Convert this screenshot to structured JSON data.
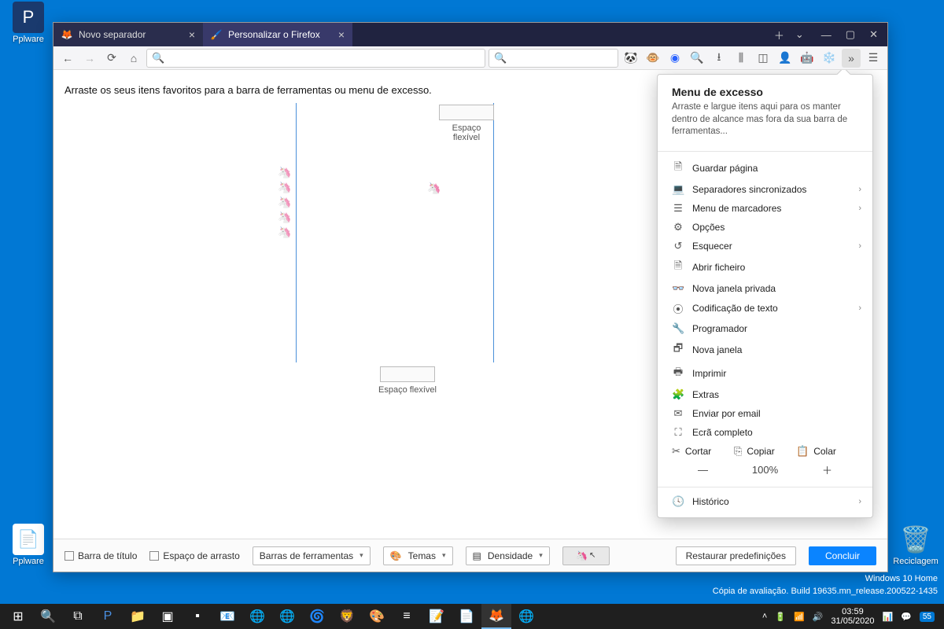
{
  "desktop": {
    "icons": [
      {
        "label": "Pplware"
      },
      {
        "label": "Pplware"
      },
      {
        "label": "Reciclagem"
      }
    ]
  },
  "window": {
    "tabs": [
      {
        "label": "Novo separador",
        "icon": "🔥",
        "active": false
      },
      {
        "label": "Personalizar o Firefox",
        "icon": "✎",
        "active": true
      }
    ]
  },
  "customize": {
    "instruction": "Arraste os seus itens favoritos para a barra de ferramentas ou menu de excesso.",
    "flex_space": "Espaço flexível"
  },
  "overflow": {
    "title": "Menu de excesso",
    "desc": "Arraste e largue itens aqui para os manter dentro de alcance mas fora da sua barra de ferramentas...",
    "items": [
      {
        "icon": "🗎",
        "label": "Guardar página",
        "arrow": false
      },
      {
        "icon": "💻",
        "label": "Separadores sincronizados",
        "arrow": true
      },
      {
        "icon": "☰",
        "label": "Menu de marcadores",
        "arrow": true
      },
      {
        "icon": "⚙",
        "label": "Opções",
        "arrow": false
      },
      {
        "icon": "↺",
        "label": "Esquecer",
        "arrow": true
      },
      {
        "icon": "🗎",
        "label": "Abrir ficheiro",
        "arrow": false
      },
      {
        "icon": "👓",
        "label": "Nova janela privada",
        "arrow": false
      },
      {
        "icon": "⦿",
        "label": "Codificação de texto",
        "arrow": true
      },
      {
        "icon": "🔧",
        "label": "Programador",
        "arrow": false
      },
      {
        "icon": "🗗",
        "label": "Nova janela",
        "arrow": false
      },
      {
        "icon": "🖶",
        "label": "Imprimir",
        "arrow": false
      },
      {
        "icon": "🧩",
        "label": "Extras",
        "arrow": false
      },
      {
        "icon": "✉",
        "label": "Enviar por email",
        "arrow": false
      },
      {
        "icon": "⛶",
        "label": "Ecrã completo",
        "arrow": false
      }
    ],
    "edit_row": {
      "cut": "Cortar",
      "copy": "Copiar",
      "paste": "Colar"
    },
    "zoom": "100%",
    "history": "Histórico"
  },
  "bottombar": {
    "title_bar": "Barra de título",
    "drag_space": "Espaço de arrasto",
    "toolbars": "Barras de ferramentas",
    "themes": "Temas",
    "density": "Densidade",
    "restore": "Restaurar predefinições",
    "done": "Concluir"
  },
  "watermark": {
    "line1": "Windows 10 Home",
    "line2": "Cópia de avaliação. Build 19635.mn_release.200522-1435"
  },
  "taskbar": {
    "time": "03:59",
    "date": "31/05/2020",
    "notif": "55"
  }
}
